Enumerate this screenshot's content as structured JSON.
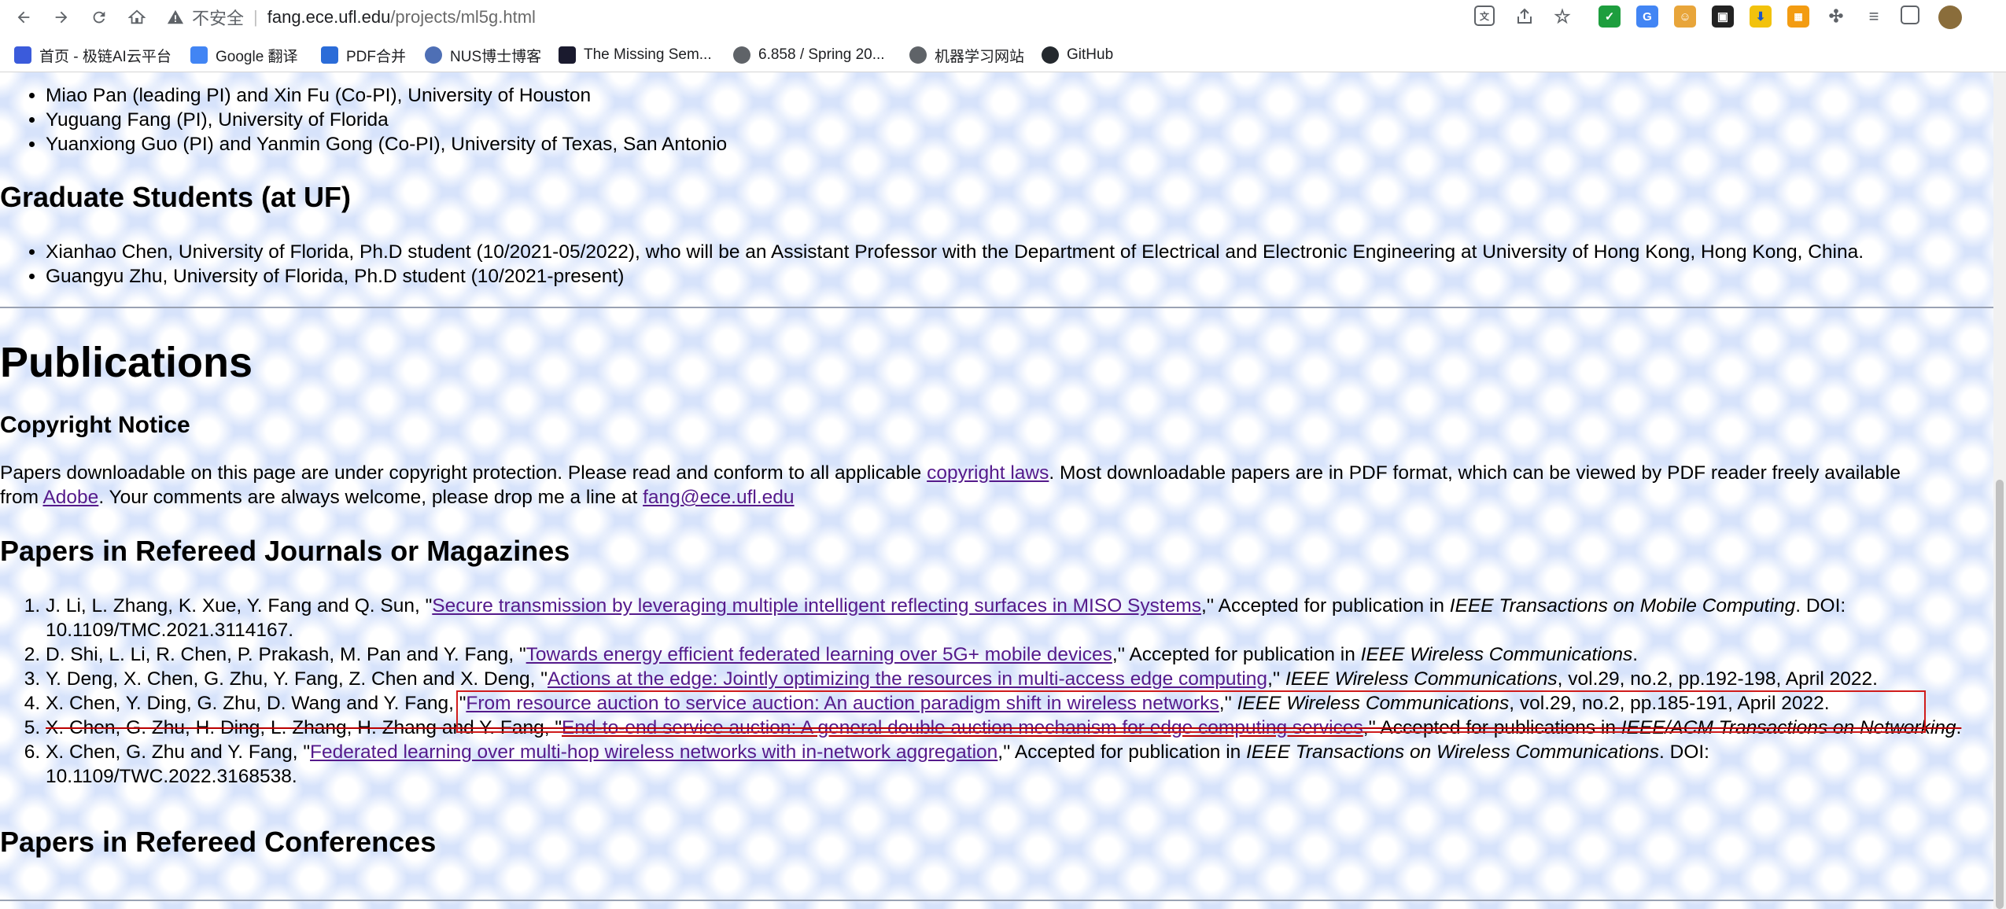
{
  "browser": {
    "insecure_label": "不安全",
    "url_host": "fang.ece.ufl.edu",
    "url_path": "/projects/ml5g.html"
  },
  "bookmarks": [
    {
      "label": "首页 - 极链AI云平台",
      "color": "#3b5bdb",
      "glyph": "AI"
    },
    {
      "label": "Google 翻译",
      "color": "#4285f4",
      "glyph": "G"
    },
    {
      "label": "PDF合并",
      "color": "#2b6cd8",
      "glyph": "P"
    },
    {
      "label": "NUS博士博客",
      "color": "#4e6fb5",
      "glyph": "W"
    },
    {
      "label": "The Missing Sem...",
      "color": "#1a1a2e",
      "glyph": ">"
    },
    {
      "label": "6.858 / Spring 20...",
      "color": "#5f6368",
      "glyph": "◍"
    },
    {
      "label": "机器学习网站",
      "color": "#5f6368",
      "glyph": "◍"
    },
    {
      "label": "GitHub",
      "color": "#24292e",
      "glyph": "◉"
    }
  ],
  "pis": [
    "Miao Pan (leading PI) and Xin Fu (Co-PI), University of Houston",
    "Yuguang Fang (PI), University of Florida",
    "Yuanxiong Guo (PI) and Yanmin Gong (Co-PI), University of Texas, San Antonio"
  ],
  "grad_heading": "Graduate Students (at UF)",
  "grad_students": [
    "Xianhao Chen, University of Florida, Ph.D student (10/2021-05/2022), who will be an Assistant Professor with the Department of Electrical and Electronic Engineering at University of Hong Kong, Hong Kong, China.",
    "Guangyu Zhu, University of Florida, Ph.D student (10/2021-present)"
  ],
  "publications_heading": "Publications",
  "copyright_heading": "Copyright Notice",
  "copyright": {
    "t1": "Papers downloadable on this page are under copyright protection. Please read and conform to all applicable ",
    "link1": "copyright laws",
    "t2": ". Most downloadable papers are in PDF format, which can be viewed by PDF reader freely available from ",
    "link2": "Adobe",
    "t3": ". Your comments are always welcome, please drop me a line at ",
    "link3": "fang@ece.ufl.edu"
  },
  "journals_heading": "Papers in Refereed Journals or Magazines",
  "journals": [
    {
      "authors": "J. Li, L. Zhang, K. Xue, Y. Fang and Q. Sun, \"",
      "title": "Secure transmission by leveraging multiple intelligent reflecting surfaces in MISO Systems",
      "mid": ",'' Accepted for publication in ",
      "venue": "IEEE Transactions on Mobile Computing",
      "tail": ". DOI: 10.1109/TMC.2021.3114167."
    },
    {
      "authors": "D. Shi, L. Li, R. Chen, P. Prakash, M. Pan and Y. Fang, \"",
      "title": "Towards energy efficient federated learning over 5G+ mobile devices",
      "mid": ",'' Accepted for publication in ",
      "venue": "IEEE Wireless Communications",
      "tail": "."
    },
    {
      "authors": "Y. Deng, X. Chen, G. Zhu, Y. Fang, Z. Chen and X. Deng, \"",
      "title": "Actions at the edge: Jointly optimizing the resources in multi-access edge computing",
      "mid": ",'' ",
      "venue": "IEEE Wireless Communications",
      "tail": ", vol.29, no.2, pp.192-198, April 2022."
    },
    {
      "authors": "X. Chen, Y. Ding, G. Zhu, D. Wang and Y. Fang, \"",
      "title": "From resource auction to service auction: An auction paradigm shift in wireless networks",
      "mid": ",'' ",
      "venue": "IEEE Wireless Communications",
      "tail": ", vol.29, no.2, pp.185-191, April 2022."
    },
    {
      "authors": "X. Chen, G. Zhu, H. Ding, L. Zhang, H. Zhang and Y. Fang, \"",
      "title": "End-to-end service auction: A general double auction mechanism for edge computing services",
      "mid": ",'' Accepted for publications in ",
      "venue": "IEEE/ACM Transactions on Networking",
      "tail": "."
    },
    {
      "authors": "X. Chen, G. Zhu and Y. Fang, \"",
      "title": "Federated learning over multi-hop wireless networks with in-network aggregation",
      "mid": ",'' Accepted for publication in ",
      "venue": "IEEE Transactions on Wireless Communications",
      "tail": ". DOI: 10.1109/TWC.2022.3168538."
    }
  ],
  "conferences_heading": "Papers in Refereed Conferences"
}
